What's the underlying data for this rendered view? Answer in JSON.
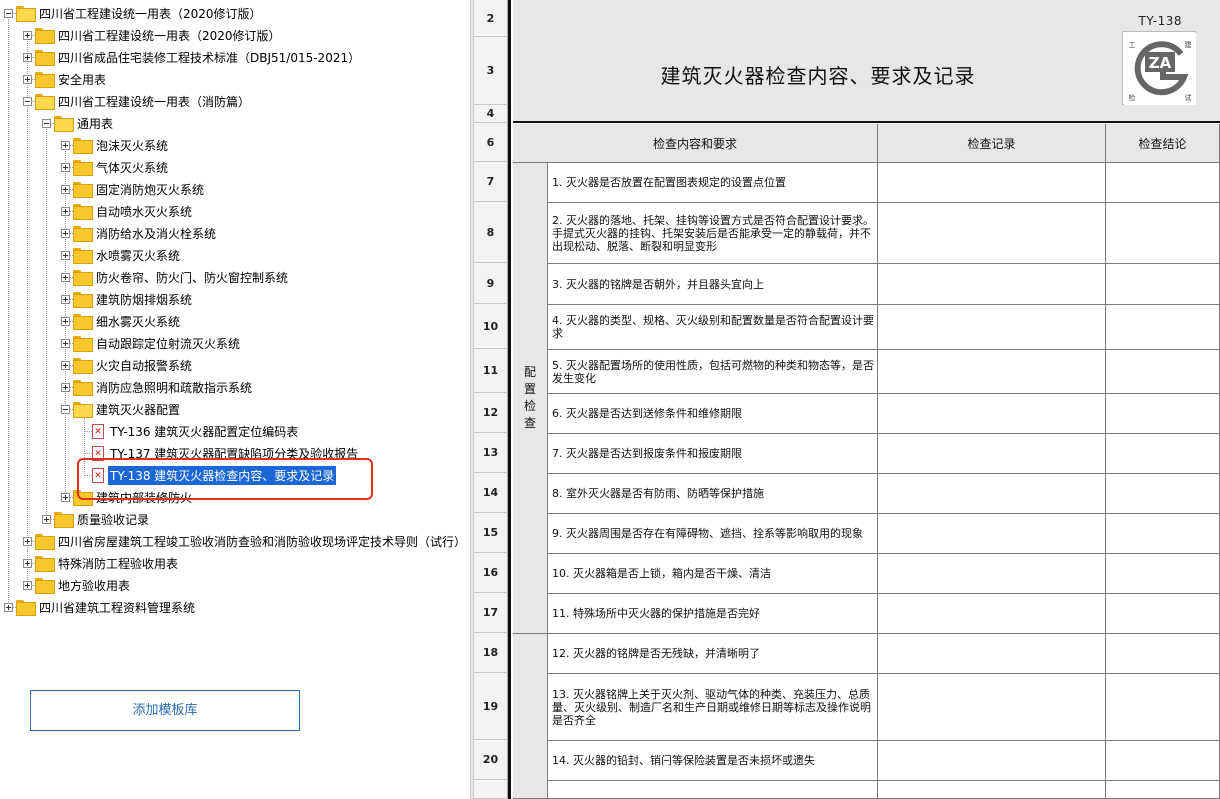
{
  "tree": {
    "nodes": [
      {
        "label": "四川省工程建设统一用表（2020修订版）",
        "name": "tree-node-sichuan-unified-2020",
        "type": "folder",
        "expanded": true
      },
      {
        "label": "四川省工程建设统一用表（2020修订版）",
        "name": "tree-node-unified-2020",
        "type": "folder",
        "expanded": false
      },
      {
        "label": "四川省成品住宅装修工程技术标准（DBJ51/015-2021）",
        "name": "tree-node-decoration-standard",
        "type": "folder",
        "expanded": false
      },
      {
        "label": "安全用表",
        "name": "tree-node-safety-forms",
        "type": "folder",
        "expanded": false
      },
      {
        "label": "四川省工程建设统一用表（消防篇）",
        "name": "tree-node-fire-forms",
        "type": "folder",
        "expanded": true
      },
      {
        "label": "通用表",
        "name": "tree-node-general-forms",
        "type": "folder",
        "expanded": true
      },
      {
        "label": "泡沫灭火系统",
        "name": "tree-node-foam-system",
        "type": "folder",
        "expanded": false
      },
      {
        "label": "气体灭火系统",
        "name": "tree-node-gas-system",
        "type": "folder",
        "expanded": false
      },
      {
        "label": "固定消防炮灭火系统",
        "name": "tree-node-fire-monitor-system",
        "type": "folder",
        "expanded": false
      },
      {
        "label": "自动喷水灭火系统",
        "name": "tree-node-sprinkler-system",
        "type": "folder",
        "expanded": false
      },
      {
        "label": "消防给水及消火栓系统",
        "name": "tree-node-hydrant-system",
        "type": "folder",
        "expanded": false
      },
      {
        "label": "水喷雾灭火系统",
        "name": "tree-node-water-spray-system",
        "type": "folder",
        "expanded": false
      },
      {
        "label": "防火卷帘、防火门、防火窗控制系统",
        "name": "tree-node-fire-door-system",
        "type": "folder",
        "expanded": false
      },
      {
        "label": "建筑防烟排烟系统",
        "name": "tree-node-smoke-control-system",
        "type": "folder",
        "expanded": false
      },
      {
        "label": "细水雾灭火系统",
        "name": "tree-node-water-mist-system",
        "type": "folder",
        "expanded": false
      },
      {
        "label": "自动跟踪定位射流灭火系统",
        "name": "tree-node-auto-tracking-system",
        "type": "folder",
        "expanded": false
      },
      {
        "label": "火灾自动报警系统",
        "name": "tree-node-fire-alarm-system",
        "type": "folder",
        "expanded": false
      },
      {
        "label": "消防应急照明和疏散指示系统",
        "name": "tree-node-emergency-lighting-system",
        "type": "folder",
        "expanded": false
      },
      {
        "label": "建筑灭火器配置",
        "name": "tree-node-extinguisher-config",
        "type": "folder",
        "expanded": true
      },
      {
        "label": "TY-136 建筑灭火器配置定位编码表",
        "name": "tree-leaf-ty136",
        "type": "file"
      },
      {
        "label": "TY-137 建筑灭火器配置缺陷项分类及验收报告",
        "name": "tree-leaf-ty137",
        "type": "file"
      },
      {
        "label": "TY-138 建筑灭火器检查内容、要求及记录",
        "name": "tree-leaf-ty138",
        "type": "file",
        "selected": true
      },
      {
        "label": "建筑内部装修防火",
        "name": "tree-node-interior-decoration",
        "type": "folder",
        "expanded": false
      },
      {
        "label": "质量验收记录",
        "name": "tree-node-quality-acceptance",
        "type": "folder",
        "expanded": false
      },
      {
        "label": "四川省房屋建筑工程竣工验收消防查验和消防验收现场评定技术导则（试行）",
        "name": "tree-node-completion-guideline",
        "type": "folder",
        "expanded": false
      },
      {
        "label": "特殊消防工程验收用表",
        "name": "tree-node-special-fire-forms",
        "type": "folder",
        "expanded": false
      },
      {
        "label": "地方验收用表",
        "name": "tree-node-local-acceptance",
        "type": "folder",
        "expanded": false
      },
      {
        "label": "四川省建筑工程资料管理系统",
        "name": "tree-node-data-management",
        "type": "folder",
        "expanded": false
      }
    ]
  },
  "add_template_label": "添加模板库",
  "sheet": {
    "form_code": "TY-138",
    "title": "建筑灭火器检查内容、要求及记录",
    "logo": {
      "text": "ZA",
      "corner_chars": [
        "工",
        "建",
        "检",
        "试"
      ],
      "icon": "za-logo"
    },
    "columns": [
      "检查内容和要求",
      "检查记录",
      "检查结论"
    ],
    "group_label": "配置检查",
    "row_numbers": [
      "2",
      "3",
      "4",
      "6",
      "7",
      "8",
      "9",
      "10",
      "11",
      "12",
      "13",
      "14",
      "15",
      "16",
      "17",
      "18",
      "19",
      "20"
    ],
    "items": [
      "1. 灭火器是否放置在配置图表规定的设置点位置",
      "2. 灭火器的落地、托架、挂钩等设置方式是否符合配置设计要求。手提式灭火器的挂钩、托架安装后是否能承受一定的静载荷，并不出现松动、脱落、断裂和明显变形",
      "3. 灭火器的铭牌是否朝外，并且器头宜向上",
      "4. 灭火器的类型、规格、灭火级别和配置数量是否符合配置设计要求",
      "5. 灭火器配置场所的使用性质，包括可燃物的种类和物态等，是否发生变化",
      "6. 灭火器是否达到送修条件和维修期限",
      "7. 灭火器是否达到报废条件和报废期限",
      "8. 室外灭火器是否有防雨、防晒等保护措施",
      "9. 灭火器周围是否存在有障碍物、遮挡、拴系等影响取用的现象",
      "10. 灭火器箱是否上锁，箱内是否干燥、清洁",
      "11. 特殊场所中灭火器的保护措施是否完好",
      "12. 灭火器的铭牌是否无残缺，并清晰明了",
      "13. 灭火器铭牌上关于灭火剂、驱动气体的种类、充装压力、总质量、灭火级别、制造厂名和生产日期或维修日期等标志及操作说明是否齐全",
      "14. 灭火器的铅封、销闩等保险装置是否未损坏或遗失"
    ]
  },
  "colors": {
    "selection": "#1b67d6",
    "folder": "#f7c72c",
    "highlight": "#e0301e",
    "button_text": "#2b6cb5"
  }
}
